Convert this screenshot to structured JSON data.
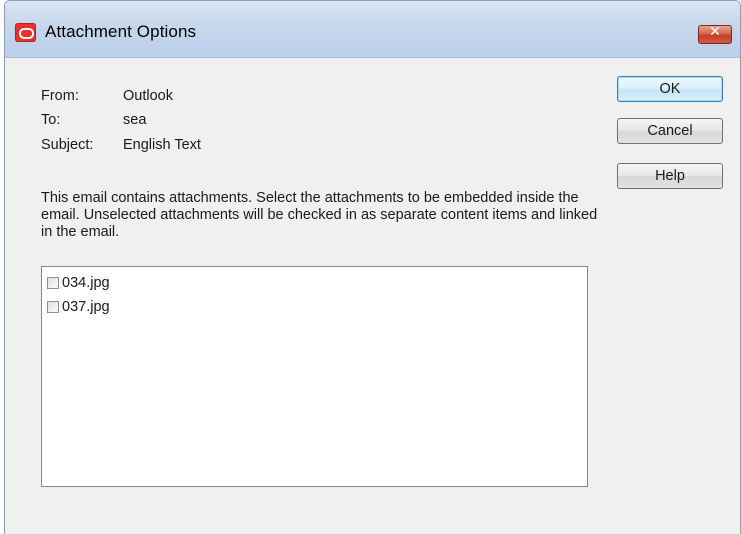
{
  "window": {
    "title": "Attachment Options",
    "close_label": "✕"
  },
  "header": {
    "from_label": "From:",
    "from_value": "Outlook",
    "to_label": "To:",
    "to_value": "sea",
    "subject_label": "Subject:",
    "subject_value": "English Text"
  },
  "description": "This email contains attachments. Select the attachments to be embedded inside the email. Unselected attachments will be checked in as separate content items and linked in the email.",
  "attachments": [
    {
      "name": "034.jpg",
      "checked": false
    },
    {
      "name": "037.jpg",
      "checked": false
    }
  ],
  "buttons": {
    "ok": "OK",
    "cancel": "Cancel",
    "help": "Help"
  },
  "colors": {
    "accent": "#3c7fb1",
    "close": "#c4402a",
    "app_icon": "#e8322d"
  },
  "icons": {
    "app": "oracle-logo-icon",
    "close": "close-icon"
  }
}
